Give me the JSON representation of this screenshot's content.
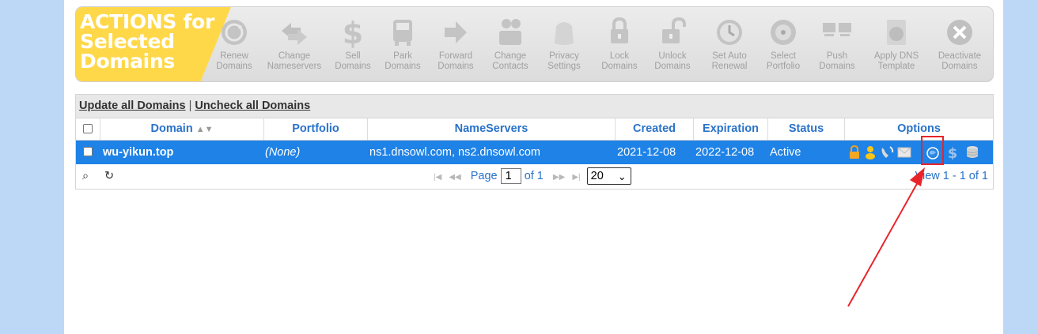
{
  "actions": {
    "title": "ACTIONS for\nSelected\nDomains",
    "items": [
      {
        "label": "Renew\nDomains",
        "icon": "renew-icon"
      },
      {
        "label": "Change\nNameservers",
        "icon": "change-nameservers-icon"
      },
      {
        "label": "Sell\nDomains",
        "icon": "dollar-icon"
      },
      {
        "label": "Park\nDomains",
        "icon": "park-icon"
      },
      {
        "label": "Forward\nDomains",
        "icon": "forward-arrow-icon"
      },
      {
        "label": "Change\nContacts",
        "icon": "contacts-icon"
      },
      {
        "label": "Privacy\nSettings",
        "icon": "privacy-icon"
      },
      {
        "label": "Lock\nDomains",
        "icon": "lock-icon"
      },
      {
        "label": "Unlock\nDomains",
        "icon": "unlock-icon"
      },
      {
        "label": "Set Auto\nRenewal",
        "icon": "clock-icon"
      },
      {
        "label": "Select\nPortfolio",
        "icon": "portfolio-icon"
      },
      {
        "label": "Push\nDomains",
        "icon": "push-icon"
      },
      {
        "label": "Apply DNS\nTemplate",
        "icon": "dns-template-icon"
      },
      {
        "label": "Deactivate\nDomains",
        "icon": "close-icon"
      }
    ]
  },
  "toolbar": {
    "update_all": "Update all Domains",
    "separator": "|",
    "uncheck_all": "Uncheck all Domains"
  },
  "columns": {
    "domain": "Domain",
    "portfolio": "Portfolio",
    "nameservers": "NameServers",
    "created": "Created",
    "expiration": "Expiration",
    "status": "Status",
    "options": "Options"
  },
  "rows": [
    {
      "domain": "wu-yikun.top",
      "portfolio": "(None)",
      "nameservers": "ns1.dnsowl.com, ns2.dnsowl.com",
      "created": "2021-12-08",
      "expiration": "2022-12-08",
      "status": "Active"
    }
  ],
  "options_icons": [
    "lock-icon",
    "contact-person-icon",
    "phone-icon",
    "email-icon",
    "dns-globe-icon",
    "dollar-icon",
    "database-icon"
  ],
  "pager": {
    "page_label": "Page",
    "page_value": "1",
    "of_label": "of 1",
    "page_size": "20",
    "view_text": "View 1 - 1 of 1"
  },
  "colors": {
    "background": "#bcd8f6",
    "header_text": "#2a72c9",
    "selected_row": "#1e82e6",
    "title_yellow": "#ffd84a",
    "highlight": "#e8242b"
  }
}
